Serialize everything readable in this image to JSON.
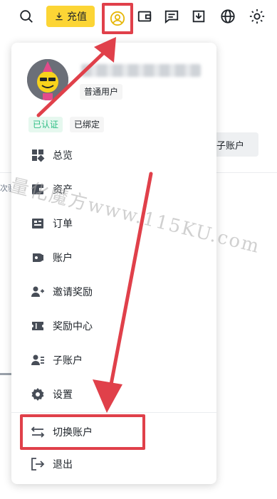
{
  "header": {
    "deposit_label": "充值",
    "icons": [
      "search-icon",
      "download-icon",
      "user-icon",
      "wallet-icon",
      "message-icon",
      "download-tray-icon",
      "globe-icon",
      "theme-icon"
    ]
  },
  "background": {
    "subaccount_fragment": "建子账户",
    "side_fragment": "次验"
  },
  "profile": {
    "user_type": "普通用户",
    "verified_tag": "已认证",
    "bound_tag": "已绑定"
  },
  "menu": {
    "items": [
      {
        "label": "总览",
        "icon": "dashboard-icon"
      },
      {
        "label": "资产",
        "icon": "wallet-icon"
      },
      {
        "label": "订单",
        "icon": "order-icon"
      },
      {
        "label": "账户",
        "icon": "account-icon"
      },
      {
        "label": "邀请奖励",
        "icon": "add-user-icon"
      },
      {
        "label": "奖励中心",
        "icon": "ticket-icon"
      },
      {
        "label": "子账户",
        "icon": "sub-account-icon"
      },
      {
        "label": "设置",
        "icon": "gear-icon"
      },
      {
        "label": "切换账户",
        "icon": "switch-icon"
      },
      {
        "label": "退出",
        "icon": "logout-icon"
      }
    ]
  },
  "watermark": "量化魔方www.115KU.com",
  "colors": {
    "brand_yellow": "#fcd535",
    "annotation_red": "#e0404a",
    "verified_green": "#2ebd85"
  }
}
